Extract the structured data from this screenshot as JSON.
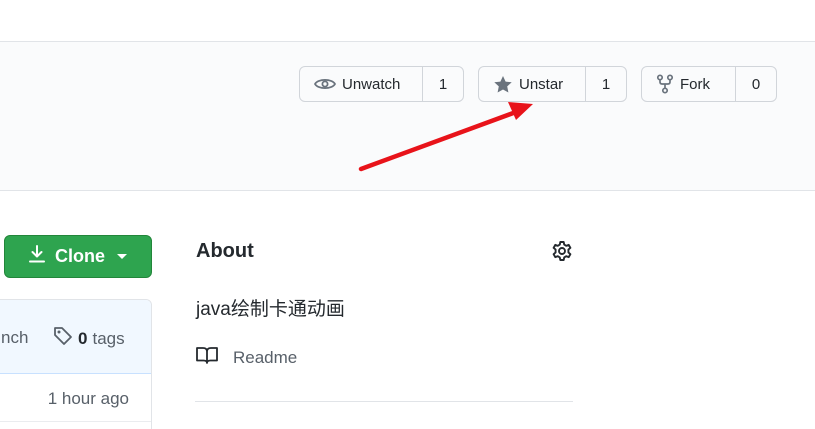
{
  "repo_actions": {
    "watch": {
      "label": "Unwatch",
      "count": "1",
      "icon": "eye-icon"
    },
    "star": {
      "label": "Unstar",
      "count": "1",
      "icon": "star-filled-icon"
    },
    "fork": {
      "label": "Fork",
      "count": "0",
      "icon": "repo-forked-icon"
    }
  },
  "code": {
    "clone_label": "Clone",
    "branch_fragment": "nch",
    "tags_count": "0",
    "tags_label": "tags",
    "last_commit_time": "1 hour ago"
  },
  "about": {
    "title": "About",
    "description": "java绘制卡通动画",
    "readme_label": "Readme"
  },
  "colors": {
    "annotation_arrow": "#e8131a",
    "clone_button": "#2ea44f",
    "icon_gray": "#6a737d"
  }
}
